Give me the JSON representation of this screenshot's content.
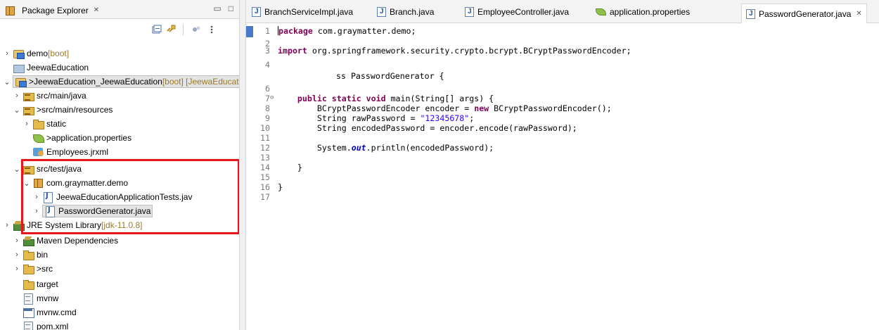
{
  "explorer": {
    "title": "Package Explorer",
    "close": "✕",
    "minimize": "▭",
    "maximize": "□"
  },
  "tree": {
    "demo": {
      "name": "demo",
      "decoration": " [boot]"
    },
    "jeewa_education": {
      "name": "JeewaEducation"
    },
    "jeewa_education_2": {
      "prefix": "> ",
      "name": "JeewaEducation_JeewaEducation",
      "decoration": " [boot] [JeewaEducation master]"
    },
    "src_main_java": {
      "name": "src/main/java"
    },
    "src_main_resources": {
      "prefix": "> ",
      "name": "src/main/resources"
    },
    "static": {
      "name": "static"
    },
    "application_properties": {
      "prefix": "> ",
      "name": "application.properties"
    },
    "employees_jrxml": {
      "name": "Employees.jrxml"
    },
    "src_test_java": {
      "name": "src/test/java"
    },
    "com_graymatter_demo": {
      "name": "com.graymatter.demo"
    },
    "jeewa_tests": {
      "name": "JeewaEducationApplicationTests.jav"
    },
    "password_generator": {
      "name": "PasswordGenerator.java"
    },
    "jre_library": {
      "name": "JRE System Library",
      "decoration": " [jdk-11.0.8]"
    },
    "maven_dependencies": {
      "name": "Maven Dependencies"
    },
    "bin": {
      "name": "bin"
    },
    "src": {
      "prefix": "> ",
      "name": "src"
    },
    "target": {
      "name": "target"
    },
    "mvnw": {
      "name": "mvnw"
    },
    "mvnw_cmd": {
      "name": "mvnw.cmd"
    },
    "pom_xml": {
      "name": "pom.xml"
    }
  },
  "editor_tabs": [
    {
      "label": "BranchServiceImpl.java"
    },
    {
      "label": "Branch.java"
    },
    {
      "label": "EmployeeController.java"
    },
    {
      "label": "application.properties"
    },
    {
      "label": "PasswordGenerator.java",
      "close": "✕"
    }
  ],
  "code": {
    "l1": {
      "n": "1",
      "kw": "package",
      "rest": " com.graymatter.demo;"
    },
    "l2": {
      "n": "2"
    },
    "l3": {
      "n": "3",
      "kw": "import",
      "rest": " org.springframework.security.crypto.bcrypt.BCryptPasswordEncoder;"
    },
    "l4": {
      "n": "4"
    },
    "l5": {
      "n": "5",
      "text": "ss PasswordGenerator {"
    },
    "l6": {
      "n": "6"
    },
    "l7": {
      "n": "7",
      "kw1": "public",
      "kw2": "static",
      "kw3": "void",
      "rest": " main(String[] args) {"
    },
    "l8": {
      "n": "8",
      "a": "BCryptPasswordEncoder encoder = ",
      "kw": "new",
      "b": " BCryptPasswordEncoder();"
    },
    "l9": {
      "n": "9",
      "a": "String rawPassword = ",
      "str": "\"12345678\"",
      "b": ";"
    },
    "l10": {
      "n": "10",
      "text": "String encodedPassword = encoder.encode(rawPassword);"
    },
    "l11": {
      "n": "11"
    },
    "l12": {
      "n": "12",
      "a": "System.",
      "fld": "out",
      "b": ".println(encodedPassword);"
    },
    "l13": {
      "n": "13"
    },
    "l14": {
      "n": "14",
      "text": "}"
    },
    "l15": {
      "n": "15"
    },
    "l16": {
      "n": "16",
      "text": "}"
    },
    "l17": {
      "n": "17"
    }
  },
  "colors": {
    "highlight_box": "#e8151b",
    "keyword": "#7f0055",
    "string": "#2a00ff",
    "decoration": "#9a7a2a"
  }
}
